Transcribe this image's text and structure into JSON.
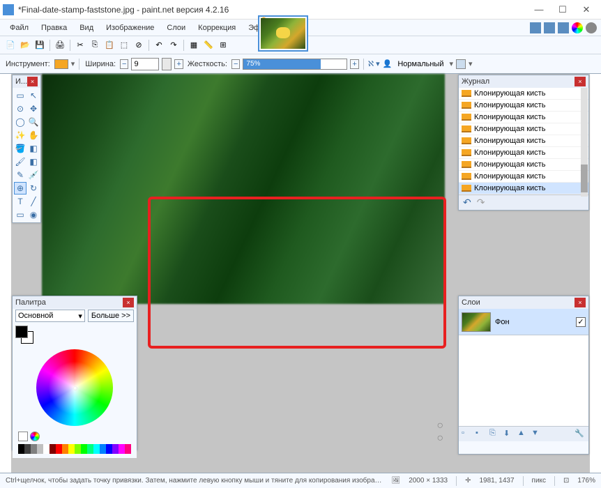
{
  "title": "*Final-date-stamp-faststone.jpg - paint.net версия 4.2.16",
  "menu": [
    "Файл",
    "Правка",
    "Вид",
    "Изображение",
    "Слои",
    "Коррекция",
    "Эффекты"
  ],
  "toolbar2": {
    "instrument_label": "Инструмент:",
    "width_label": "Ширина:",
    "width_value": "9",
    "stiffness_label": "Жесткость:",
    "stiffness_value": "75%",
    "stiffness_pct": 75,
    "blend_label": "Нормальный"
  },
  "tools_panel_title": "И...",
  "history": {
    "title": "Журнал",
    "items": [
      "Клонирующая кисть",
      "Клонирующая кисть",
      "Клонирующая кисть",
      "Клонирующая кисть",
      "Клонирующая кисть",
      "Клонирующая кисть",
      "Клонирующая кисть",
      "Клонирующая кисть",
      "Клонирующая кисть"
    ],
    "selected_index": 8
  },
  "layers": {
    "title": "Слои",
    "items": [
      {
        "name": "Фон",
        "checked": true
      }
    ]
  },
  "palette": {
    "title": "Палитра",
    "primary_label": "Основной",
    "more_label": "Больше >>",
    "strip": [
      "#000",
      "#404040",
      "#808080",
      "#c0c0c0",
      "#fff",
      "#800000",
      "#f00",
      "#ff8000",
      "#ff0",
      "#80ff00",
      "#0f0",
      "#00ff80",
      "#0ff",
      "#0080ff",
      "#00f",
      "#8000ff",
      "#f0f",
      "#ff0080"
    ]
  },
  "status": {
    "hint": "Ctrl+щелчок, чтобы задать точку привязки. Затем, нажмите левую кнопку мыши и тяните для копирования изображения вокруг точки...",
    "size": "2000 × 1333",
    "cursor": "1981, 1437",
    "unit": "пикс",
    "zoom": "176%"
  }
}
